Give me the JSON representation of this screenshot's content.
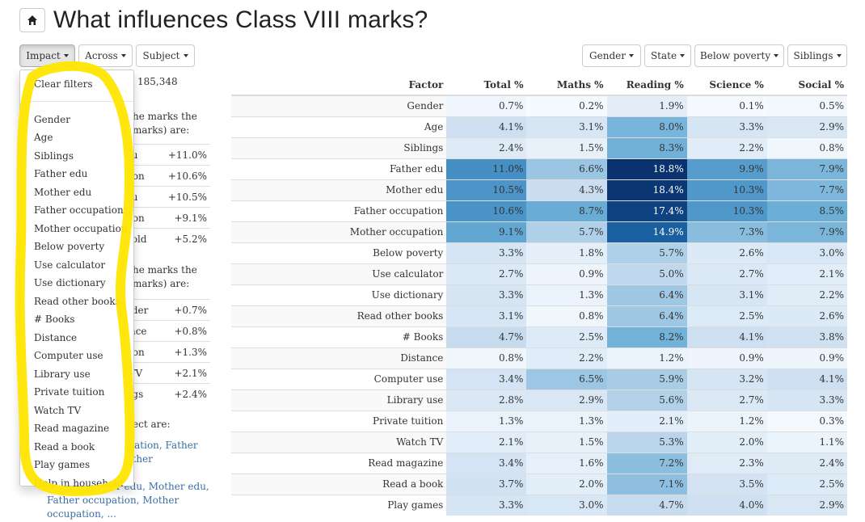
{
  "header": {
    "title": "What influences Class VIII marks?",
    "home_icon": "home-icon"
  },
  "toolbar_left": [
    {
      "label": "Impact",
      "active": true
    },
    {
      "label": "Across",
      "active": false
    },
    {
      "label": "Subject",
      "active": false
    }
  ],
  "toolbar_right": [
    {
      "label": "Gender"
    },
    {
      "label": "State"
    },
    {
      "label": "Below poverty"
    },
    {
      "label": "Siblings"
    }
  ],
  "dropdown": {
    "clear_label": "Clear filters",
    "items": [
      "Gender",
      "Age",
      "Siblings",
      "Father edu",
      "Mother edu",
      "Father occupation",
      "Mother occupation",
      "Below poverty",
      "Use calculator",
      "Use dictionary",
      "Read other books",
      "# Books",
      "Distance",
      "Computer use",
      "Library use",
      "Private tuition",
      "Watch TV",
      "Read magazine",
      "Read a book",
      "Play games",
      "Help in household"
    ]
  },
  "left_panel": {
    "count": "185,348",
    "top_text": "he marks the marks) are:",
    "top_rows": [
      {
        "name": "edu",
        "value": "+11.0%"
      },
      {
        "name": "ation",
        "value": "+10.6%"
      },
      {
        "name": "edu",
        "value": "+10.5%"
      },
      {
        "name": "ation",
        "value": "+9.1%"
      },
      {
        "name": "ehold",
        "value": "+5.2%"
      }
    ],
    "bottom_text": "he marks the marks) are:",
    "bottom_rows": [
      {
        "name": "ender",
        "value": "+0.7%"
      },
      {
        "name": "tance",
        "value": "+0.8%"
      },
      {
        "name": "ation",
        "value": "+1.3%"
      },
      {
        "name": "h TV",
        "value": "+2.1%"
      },
      {
        "name": "lings",
        "value": "+2.4%"
      }
    ],
    "subject_text": "ect are:",
    "link_line1": "cupation, Father",
    "link_line2": "Mother",
    "link_line3": "r edu, Mother edu,",
    "link_line4": "Father occupation, Mother",
    "link_line5": "occupation, ..."
  },
  "table": {
    "headers": [
      "Factor",
      "Total %",
      "Maths %",
      "Reading %",
      "Science %",
      "Social %"
    ],
    "rows": [
      [
        "Gender",
        "0.7%",
        "0.2%",
        "1.9%",
        "0.1%",
        "0.5%"
      ],
      [
        "Age",
        "4.1%",
        "3.1%",
        "8.0%",
        "3.3%",
        "2.9%"
      ],
      [
        "Siblings",
        "2.4%",
        "1.5%",
        "8.3%",
        "2.2%",
        "0.8%"
      ],
      [
        "Father edu",
        "11.0%",
        "6.6%",
        "18.8%",
        "9.9%",
        "7.9%"
      ],
      [
        "Mother edu",
        "10.5%",
        "4.3%",
        "18.4%",
        "10.3%",
        "7.7%"
      ],
      [
        "Father occupation",
        "10.6%",
        "8.7%",
        "17.4%",
        "10.3%",
        "8.5%"
      ],
      [
        "Mother occupation",
        "9.1%",
        "5.7%",
        "14.9%",
        "7.3%",
        "7.9%"
      ],
      [
        "Below poverty",
        "3.3%",
        "1.8%",
        "5.7%",
        "2.6%",
        "3.0%"
      ],
      [
        "Use calculator",
        "2.7%",
        "0.9%",
        "5.0%",
        "2.7%",
        "2.1%"
      ],
      [
        "Use dictionary",
        "3.3%",
        "1.3%",
        "6.4%",
        "3.1%",
        "2.2%"
      ],
      [
        "Read other books",
        "3.1%",
        "0.8%",
        "6.4%",
        "2.5%",
        "2.6%"
      ],
      [
        "# Books",
        "4.7%",
        "2.5%",
        "8.2%",
        "4.1%",
        "3.8%"
      ],
      [
        "Distance",
        "0.8%",
        "2.2%",
        "1.2%",
        "0.9%",
        "0.9%"
      ],
      [
        "Computer use",
        "3.4%",
        "6.5%",
        "5.9%",
        "3.2%",
        "4.1%"
      ],
      [
        "Library use",
        "2.8%",
        "2.9%",
        "5.6%",
        "2.7%",
        "3.3%"
      ],
      [
        "Private tuition",
        "1.3%",
        "1.3%",
        "2.1%",
        "1.2%",
        "0.3%"
      ],
      [
        "Watch TV",
        "2.1%",
        "1.5%",
        "5.3%",
        "2.0%",
        "1.1%"
      ],
      [
        "Read magazine",
        "3.4%",
        "1.6%",
        "7.2%",
        "2.3%",
        "2.4%"
      ],
      [
        "Read a book",
        "3.7%",
        "2.0%",
        "7.1%",
        "3.5%",
        "2.5%"
      ],
      [
        "Play games",
        "3.3%",
        "3.0%",
        "4.7%",
        "4.0%",
        "2.9%"
      ]
    ]
  },
  "colors": {
    "scale_low": "#f7fbff",
    "scale_high": "#08306b",
    "annotation": "#ffe600"
  }
}
